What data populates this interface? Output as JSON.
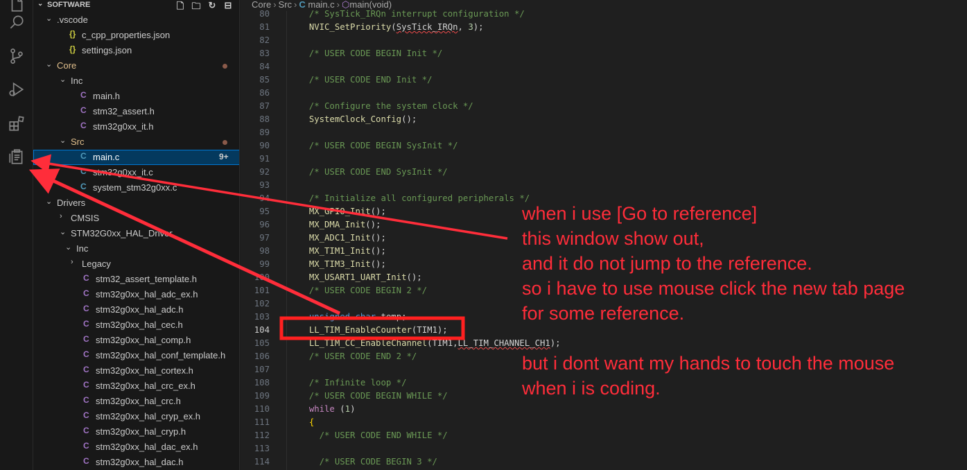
{
  "activity_bar": {
    "items": [
      "explorer-icon",
      "search-icon",
      "source-control-icon",
      "run-debug-icon",
      "extensions-icon",
      "references-icon"
    ]
  },
  "sidebar": {
    "title": "SOFTWARE",
    "tree": [
      {
        "label": ".vscode",
        "kind": "folder",
        "open": true,
        "depth": 0
      },
      {
        "label": "c_cpp_properties.json",
        "kind": "json",
        "depth": 1
      },
      {
        "label": "settings.json",
        "kind": "json",
        "depth": 1
      },
      {
        "label": "Core",
        "kind": "folder",
        "open": true,
        "depth": 0,
        "modified": true
      },
      {
        "label": "Inc",
        "kind": "folder",
        "open": true,
        "depth": 1
      },
      {
        "label": "main.h",
        "kind": "h",
        "depth": 2
      },
      {
        "label": "stm32_assert.h",
        "kind": "h",
        "depth": 2
      },
      {
        "label": "stm32g0xx_it.h",
        "kind": "h",
        "depth": 2
      },
      {
        "label": "Src",
        "kind": "folder",
        "open": true,
        "depth": 1,
        "modified": true
      },
      {
        "label": "main.c",
        "kind": "c",
        "depth": 2,
        "selected": true,
        "badge": "9+"
      },
      {
        "label": "stm32g0xx_it.c",
        "kind": "c",
        "depth": 2
      },
      {
        "label": "system_stm32g0xx.c",
        "kind": "c",
        "depth": 2
      },
      {
        "label": "Drivers",
        "kind": "folder",
        "open": true,
        "depth": 0
      },
      {
        "label": "CMSIS",
        "kind": "folder",
        "open": false,
        "depth": 1
      },
      {
        "label": "STM32G0xx_HAL_Driver",
        "kind": "folder",
        "open": true,
        "depth": 1
      },
      {
        "label": "Inc",
        "kind": "folder",
        "open": true,
        "depth": 2
      },
      {
        "label": "Legacy",
        "kind": "folder",
        "open": false,
        "depth": 3
      },
      {
        "label": "stm32_assert_template.h",
        "kind": "h",
        "depth": 3
      },
      {
        "label": "stm32g0xx_hal_adc_ex.h",
        "kind": "h",
        "depth": 3
      },
      {
        "label": "stm32g0xx_hal_adc.h",
        "kind": "h",
        "depth": 3
      },
      {
        "label": "stm32g0xx_hal_cec.h",
        "kind": "h",
        "depth": 3
      },
      {
        "label": "stm32g0xx_hal_comp.h",
        "kind": "h",
        "depth": 3
      },
      {
        "label": "stm32g0xx_hal_conf_template.h",
        "kind": "h",
        "depth": 3
      },
      {
        "label": "stm32g0xx_hal_cortex.h",
        "kind": "h",
        "depth": 3
      },
      {
        "label": "stm32g0xx_hal_crc_ex.h",
        "kind": "h",
        "depth": 3
      },
      {
        "label": "stm32g0xx_hal_crc.h",
        "kind": "h",
        "depth": 3
      },
      {
        "label": "stm32g0xx_hal_cryp_ex.h",
        "kind": "h",
        "depth": 3
      },
      {
        "label": "stm32g0xx_hal_cryp.h",
        "kind": "h",
        "depth": 3
      },
      {
        "label": "stm32g0xx_hal_dac_ex.h",
        "kind": "h",
        "depth": 3
      },
      {
        "label": "stm32g0xx_hal_dac.h",
        "kind": "h",
        "depth": 3
      }
    ]
  },
  "breadcrumb": {
    "parts": [
      "Core",
      "Src",
      "main.c",
      "main(void)"
    ]
  },
  "editor": {
    "current_line": "104",
    "lines": [
      {
        "n": "80",
        "code": "  /* SysTick_IRQn interrupt configuration */"
      },
      {
        "n": "81",
        "code": "  NVIC_SetPriority(SysTick_IRQn, 3);"
      },
      {
        "n": "82",
        "code": ""
      },
      {
        "n": "83",
        "code": "  /* USER CODE BEGIN Init */"
      },
      {
        "n": "84",
        "code": ""
      },
      {
        "n": "85",
        "code": "  /* USER CODE END Init */"
      },
      {
        "n": "86",
        "code": ""
      },
      {
        "n": "87",
        "code": "  /* Configure the system clock */"
      },
      {
        "n": "88",
        "code": "  SystemClock_Config();"
      },
      {
        "n": "89",
        "code": ""
      },
      {
        "n": "90",
        "code": "  /* USER CODE BEGIN SysInit */"
      },
      {
        "n": "91",
        "code": ""
      },
      {
        "n": "92",
        "code": "  /* USER CODE END SysInit */"
      },
      {
        "n": "93",
        "code": ""
      },
      {
        "n": "94",
        "code": "  /* Initialize all configured peripherals */"
      },
      {
        "n": "95",
        "code": "  MX_GPIO_Init();"
      },
      {
        "n": "96",
        "code": "  MX_DMA_Init();"
      },
      {
        "n": "97",
        "code": "  MX_ADC1_Init();"
      },
      {
        "n": "98",
        "code": "  MX_TIM1_Init();"
      },
      {
        "n": "99",
        "code": "  MX_TIM3_Init();"
      },
      {
        "n": "100",
        "code": "  MX_USART1_UART_Init();"
      },
      {
        "n": "101",
        "code": "  /* USER CODE BEGIN 2 */"
      },
      {
        "n": "102",
        "code": ""
      },
      {
        "n": "103",
        "code": "  unsigned char temp;"
      },
      {
        "n": "104",
        "code": "  LL_TIM_EnableCounter(TIM1);"
      },
      {
        "n": "105",
        "code": "  LL_TIM_CC_EnableChannel(TIM1,LL_TIM_CHANNEL_CH1);"
      },
      {
        "n": "106",
        "code": "  /* USER CODE END 2 */"
      },
      {
        "n": "107",
        "code": ""
      },
      {
        "n": "108",
        "code": "  /* Infinite loop */"
      },
      {
        "n": "109",
        "code": "  /* USER CODE BEGIN WHILE */"
      },
      {
        "n": "110",
        "code": "  while (1)"
      },
      {
        "n": "111",
        "code": "  {"
      },
      {
        "n": "112",
        "code": "    /* USER CODE END WHILE */"
      },
      {
        "n": "113",
        "code": ""
      },
      {
        "n": "114",
        "code": "    /* USER CODE BEGIN 3 */"
      }
    ]
  },
  "annotation": {
    "color": "#ff2d3a",
    "lines_top": [
      "when i use [Go to reference]",
      "this window show out,",
      "and it do not jump to the reference.",
      "so i have to use mouse click the new tab page",
      "for some reference."
    ],
    "lines_bottom": [
      "but i dont want my hands to touch the mouse",
      "when i is coding."
    ]
  }
}
